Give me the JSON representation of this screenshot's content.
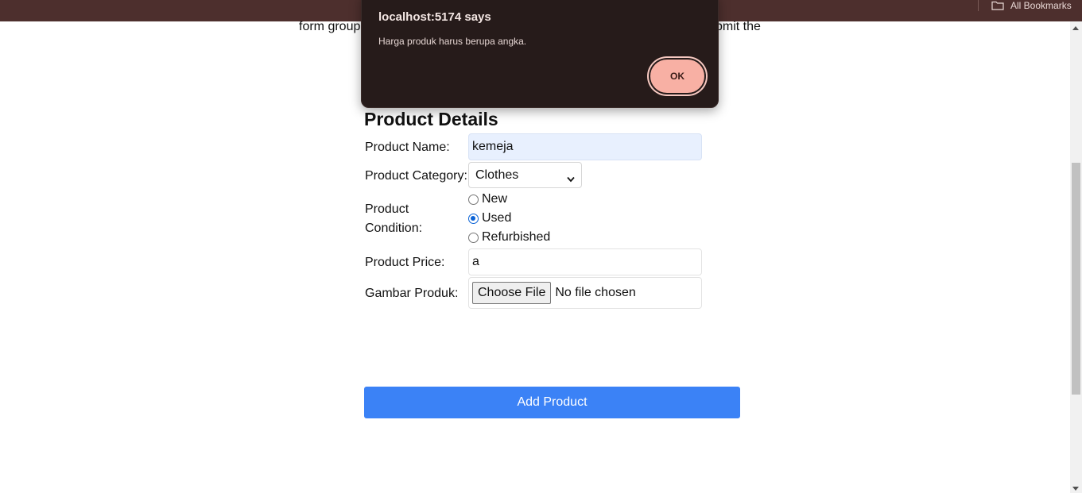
{
  "browser": {
    "bookmarks_label": "All Bookmarks"
  },
  "page": {
    "intro_left": "form group",
    "intro_right": "bmit the"
  },
  "form": {
    "title": "Product Details",
    "name_label": "Product Name:",
    "name_value": "kemeja",
    "category_label": "Product Category:",
    "category_value": "Clothes",
    "condition_label_line1": "Product",
    "condition_label_line2": "Condition:",
    "conditions": [
      {
        "label": "New",
        "checked": false
      },
      {
        "label": "Used",
        "checked": true
      },
      {
        "label": "Refurbished",
        "checked": false
      }
    ],
    "price_label": "Product Price:",
    "price_value": "a",
    "image_label": "Gambar Produk:",
    "file_button": "Choose File",
    "file_status": "No file chosen",
    "submit_label": "Add Product"
  },
  "dialog": {
    "title": "localhost:5174 says",
    "message": "Harga produk harus berupa angka.",
    "ok_label": "OK"
  },
  "colors": {
    "topbar": "#4d2f2d",
    "dialog_bg": "#261b1a",
    "ok_button": "#f8b0a4",
    "submit_button": "#3b82f6",
    "radio_checked": "#0b63d6",
    "autofill_bg": "#e8f0fe"
  }
}
